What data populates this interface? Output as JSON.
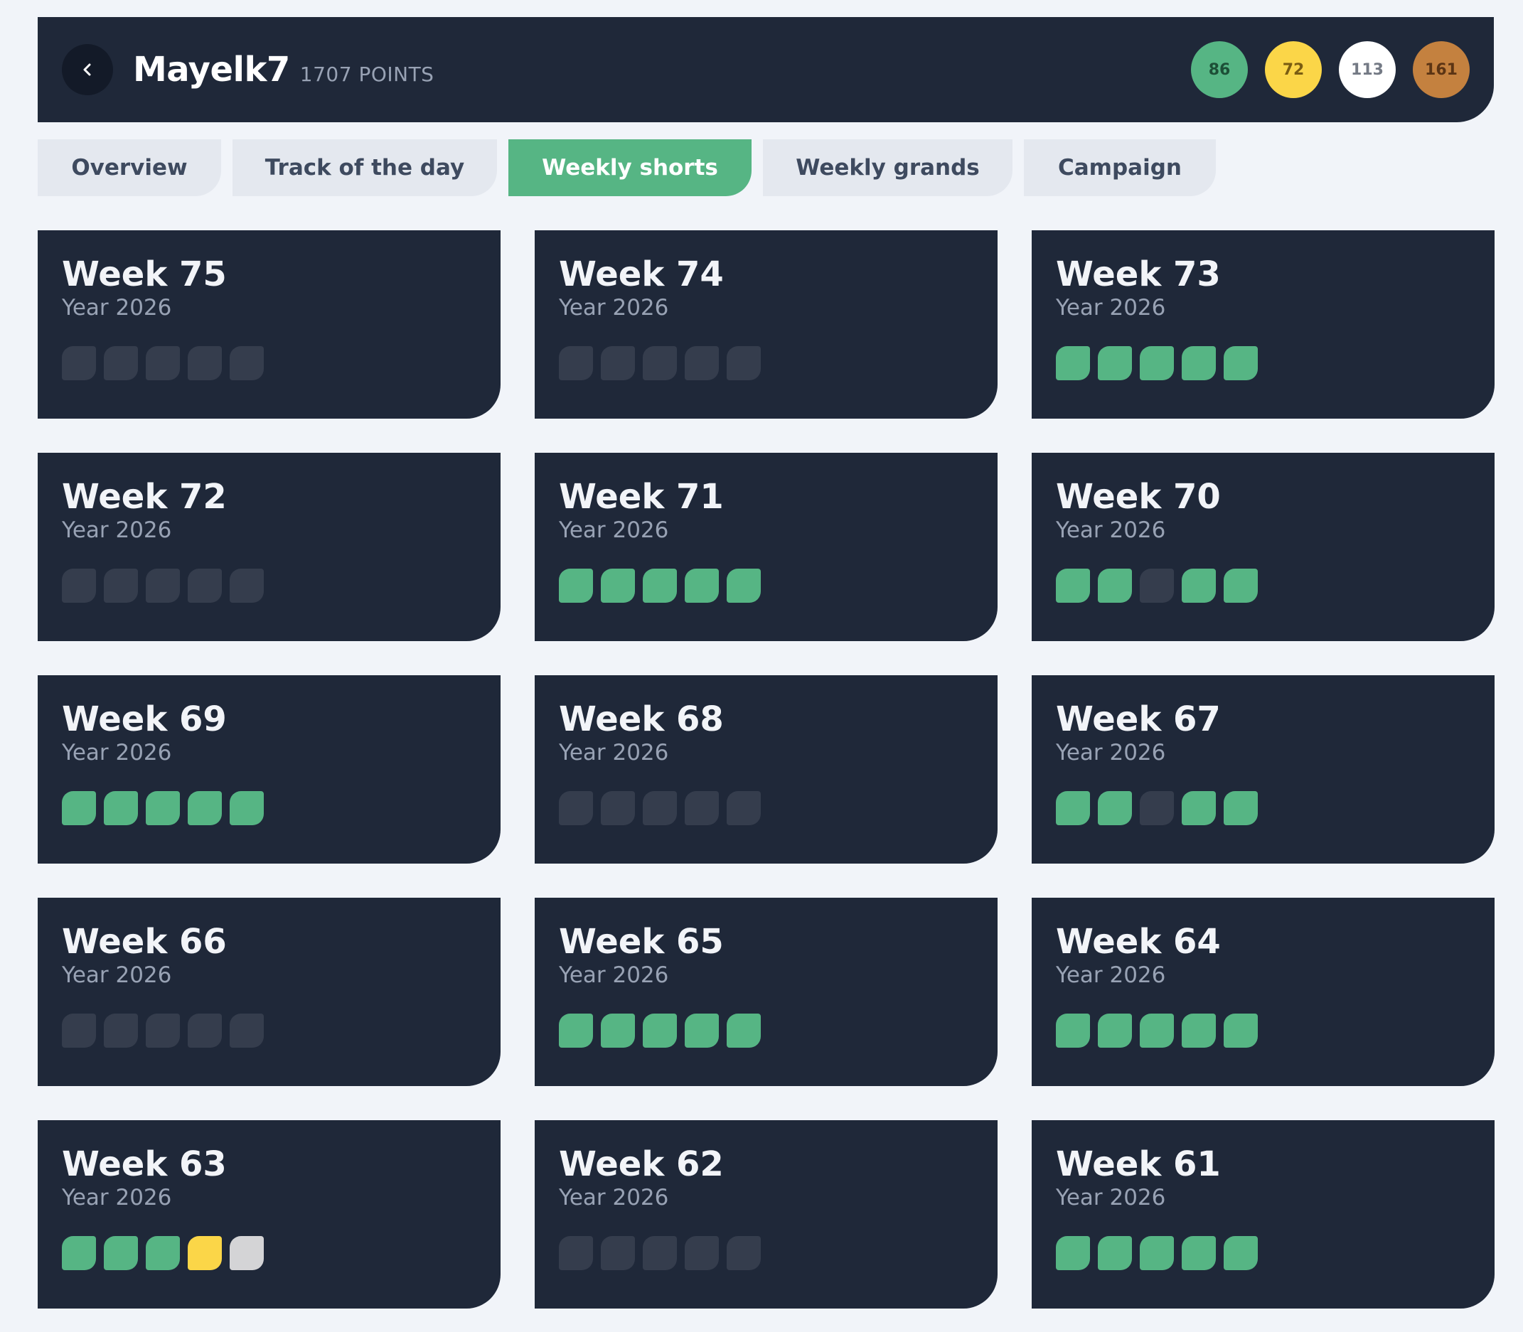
{
  "header": {
    "name": "Mayelk7",
    "points": "1707 POINTS",
    "medals": [
      {
        "value": "86",
        "bg": "#56b584",
        "fg": "#1d4f37",
        "name": "green-medal"
      },
      {
        "value": "72",
        "bg": "#fbd648",
        "fg": "#7a5d12",
        "name": "gold-medal"
      },
      {
        "value": "113",
        "bg": "#ffffff",
        "fg": "#747a85",
        "name": "silver-medal"
      },
      {
        "value": "161",
        "bg": "#c4813f",
        "fg": "#5b3414",
        "name": "bronze-medal"
      }
    ]
  },
  "tabs": [
    {
      "label": "Overview",
      "active": false
    },
    {
      "label": "Track of the day",
      "active": false
    },
    {
      "label": "Weekly shorts",
      "active": true
    },
    {
      "label": "Weekly grands",
      "active": false
    },
    {
      "label": "Campaign",
      "active": false
    }
  ],
  "colors": {
    "green": "#56b584",
    "yellow": "#fbd648",
    "white": "#d4d4d6",
    "empty": "#353d4d"
  },
  "weeks": [
    {
      "title": "Week 75",
      "year": "Year 2026",
      "tracks": [
        "empty",
        "empty",
        "empty",
        "empty",
        "empty"
      ]
    },
    {
      "title": "Week 74",
      "year": "Year 2026",
      "tracks": [
        "empty",
        "empty",
        "empty",
        "empty",
        "empty"
      ]
    },
    {
      "title": "Week 73",
      "year": "Year 2026",
      "tracks": [
        "green",
        "green",
        "green",
        "green",
        "green"
      ]
    },
    {
      "title": "Week 72",
      "year": "Year 2026",
      "tracks": [
        "empty",
        "empty",
        "empty",
        "empty",
        "empty"
      ]
    },
    {
      "title": "Week 71",
      "year": "Year 2026",
      "tracks": [
        "green",
        "green",
        "green",
        "green",
        "green"
      ]
    },
    {
      "title": "Week 70",
      "year": "Year 2026",
      "tracks": [
        "green",
        "green",
        "empty",
        "green",
        "green"
      ]
    },
    {
      "title": "Week 69",
      "year": "Year 2026",
      "tracks": [
        "green",
        "green",
        "green",
        "green",
        "green"
      ]
    },
    {
      "title": "Week 68",
      "year": "Year 2026",
      "tracks": [
        "empty",
        "empty",
        "empty",
        "empty",
        "empty"
      ]
    },
    {
      "title": "Week 67",
      "year": "Year 2026",
      "tracks": [
        "green",
        "green",
        "empty",
        "green",
        "green"
      ]
    },
    {
      "title": "Week 66",
      "year": "Year 2026",
      "tracks": [
        "empty",
        "empty",
        "empty",
        "empty",
        "empty"
      ]
    },
    {
      "title": "Week 65",
      "year": "Year 2026",
      "tracks": [
        "green",
        "green",
        "green",
        "green",
        "green"
      ]
    },
    {
      "title": "Week 64",
      "year": "Year 2026",
      "tracks": [
        "green",
        "green",
        "green",
        "green",
        "green"
      ]
    },
    {
      "title": "Week 63",
      "year": "Year 2026",
      "tracks": [
        "green",
        "green",
        "green",
        "yellow",
        "white"
      ]
    },
    {
      "title": "Week 62",
      "year": "Year 2026",
      "tracks": [
        "empty",
        "empty",
        "empty",
        "empty",
        "empty"
      ]
    },
    {
      "title": "Week 61",
      "year": "Year 2026",
      "tracks": [
        "green",
        "green",
        "green",
        "green",
        "green"
      ]
    }
  ]
}
